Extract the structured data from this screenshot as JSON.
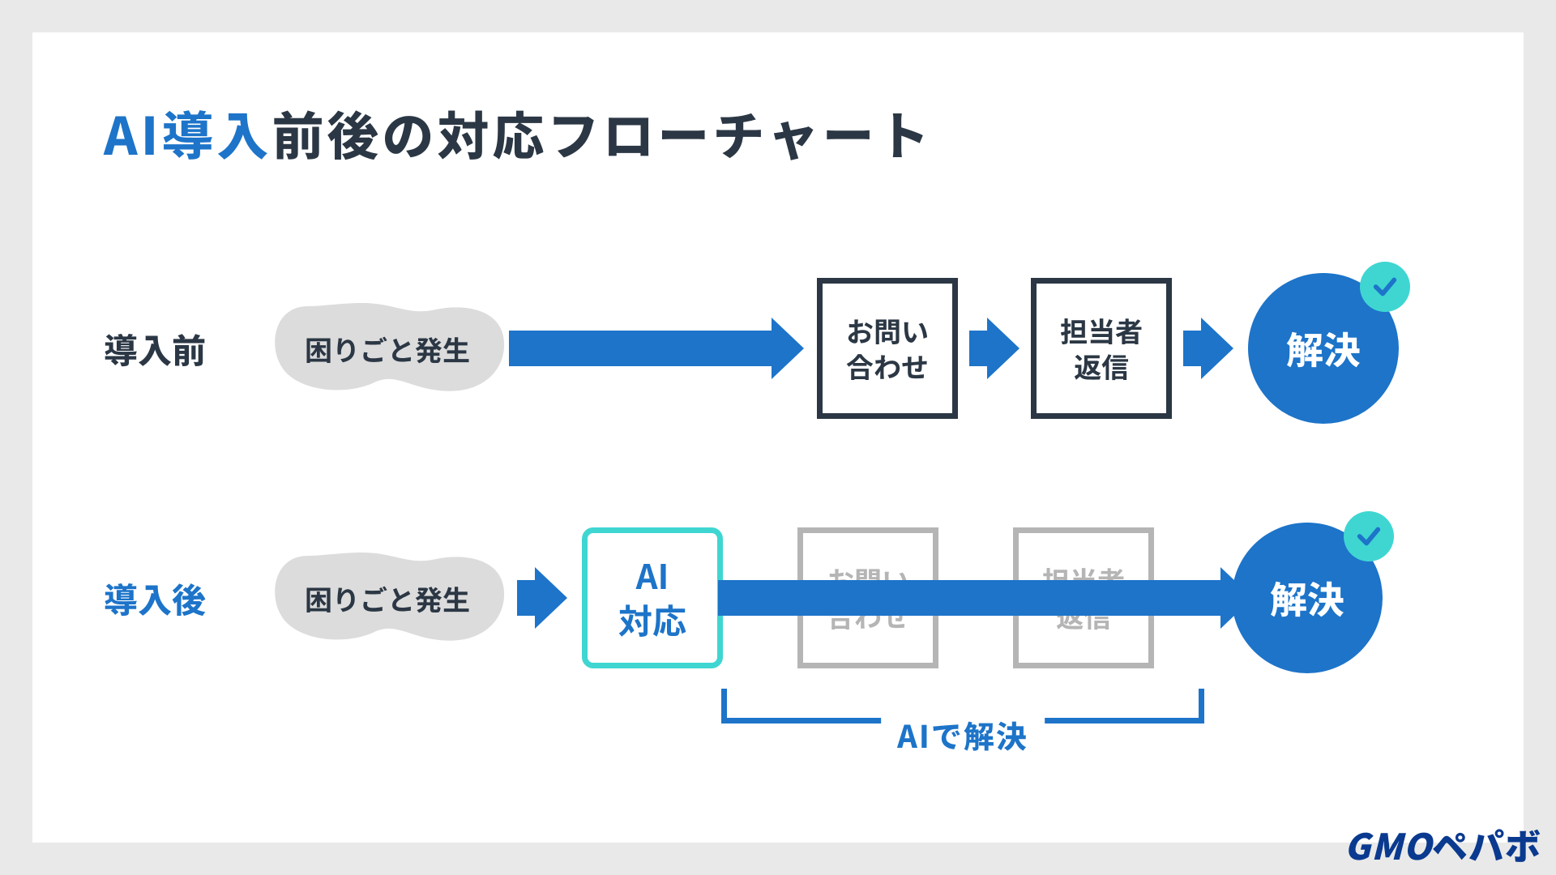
{
  "title": {
    "accent": "AI導入",
    "rest": "前後の対応フローチャート"
  },
  "flow_before": {
    "label": "導入前",
    "trouble": "困りごと発生",
    "inquiry": "お問い\n合わせ",
    "reply": "担当者\n返信",
    "solve": "解決"
  },
  "flow_after": {
    "label": "導入後",
    "trouble": "困りごと発生",
    "ai": "AI\n対応",
    "inquiry": "お問い\n合わせ",
    "reply": "担当者\n返信",
    "solve": "解決",
    "bracket_label": "AIで解決"
  },
  "logo": {
    "prefix": "GMO",
    "suffix": "ペパボ"
  }
}
